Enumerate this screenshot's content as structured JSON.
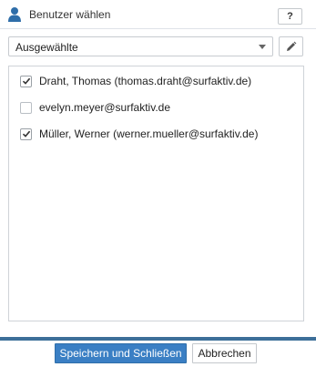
{
  "header": {
    "title": "Benutzer wählen",
    "help_label": "?",
    "icon": "user-icon"
  },
  "filter": {
    "selected": "Ausgewählte",
    "edit_icon": "pencil-icon"
  },
  "users": [
    {
      "label": "Draht, Thomas (thomas.draht@surfaktiv.de)",
      "checked": true
    },
    {
      "label": "evelyn.meyer@surfaktiv.de",
      "checked": false
    },
    {
      "label": "Müller, Werner (werner.mueller@surfaktiv.de)",
      "checked": true
    }
  ],
  "footer": {
    "save_label": "Speichern und Schließen",
    "cancel_label": "Abbrechen"
  },
  "colors": {
    "accent": "#3a7fc4",
    "footer_bar": "#3d6f99"
  }
}
